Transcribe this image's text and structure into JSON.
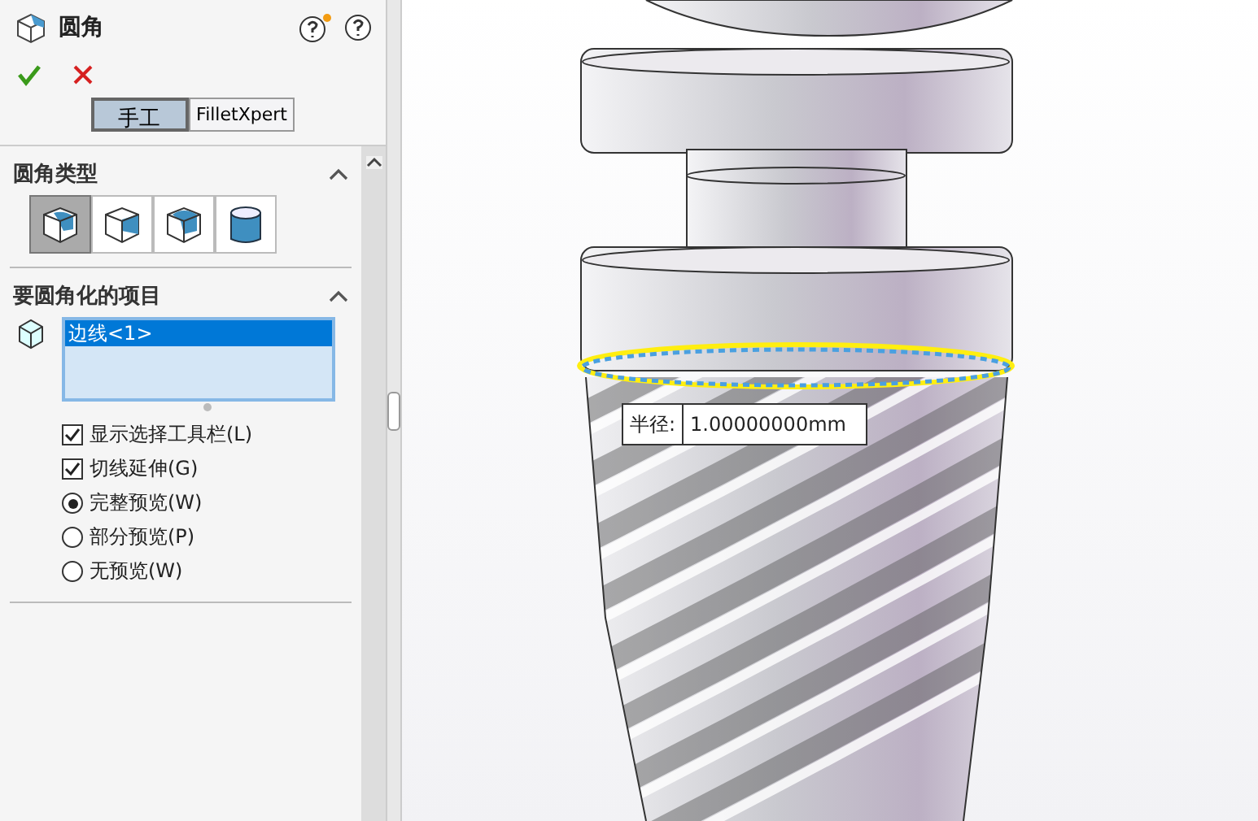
{
  "panel": {
    "title": "圆角"
  },
  "mode_tabs": [
    {
      "label": "手工",
      "selected": true
    },
    {
      "label": "FilletXpert",
      "selected": false
    }
  ],
  "fillet_type": {
    "title": "圆角类型",
    "expanded": true,
    "options": [
      {
        "kind": "constant",
        "selected": true
      },
      {
        "kind": "variable",
        "selected": false
      },
      {
        "kind": "face",
        "selected": false
      },
      {
        "kind": "full",
        "selected": false
      }
    ]
  },
  "items": {
    "title": "要圆角化的项目",
    "expanded": true,
    "list": [
      {
        "label": "边线<1>",
        "selected": true
      }
    ],
    "checkboxes": [
      {
        "label": "显示选择工具栏(L)",
        "checked": true
      },
      {
        "label": "切线延伸(G)",
        "checked": true
      }
    ],
    "radios": [
      {
        "label": "完整预览(W)",
        "selected": true
      },
      {
        "label": "部分预览(P)",
        "selected": false
      },
      {
        "label": "无预览(W)",
        "selected": false
      }
    ]
  },
  "viewport": {
    "dimension": {
      "label": "半径:",
      "value": "1.00000000mm"
    }
  }
}
